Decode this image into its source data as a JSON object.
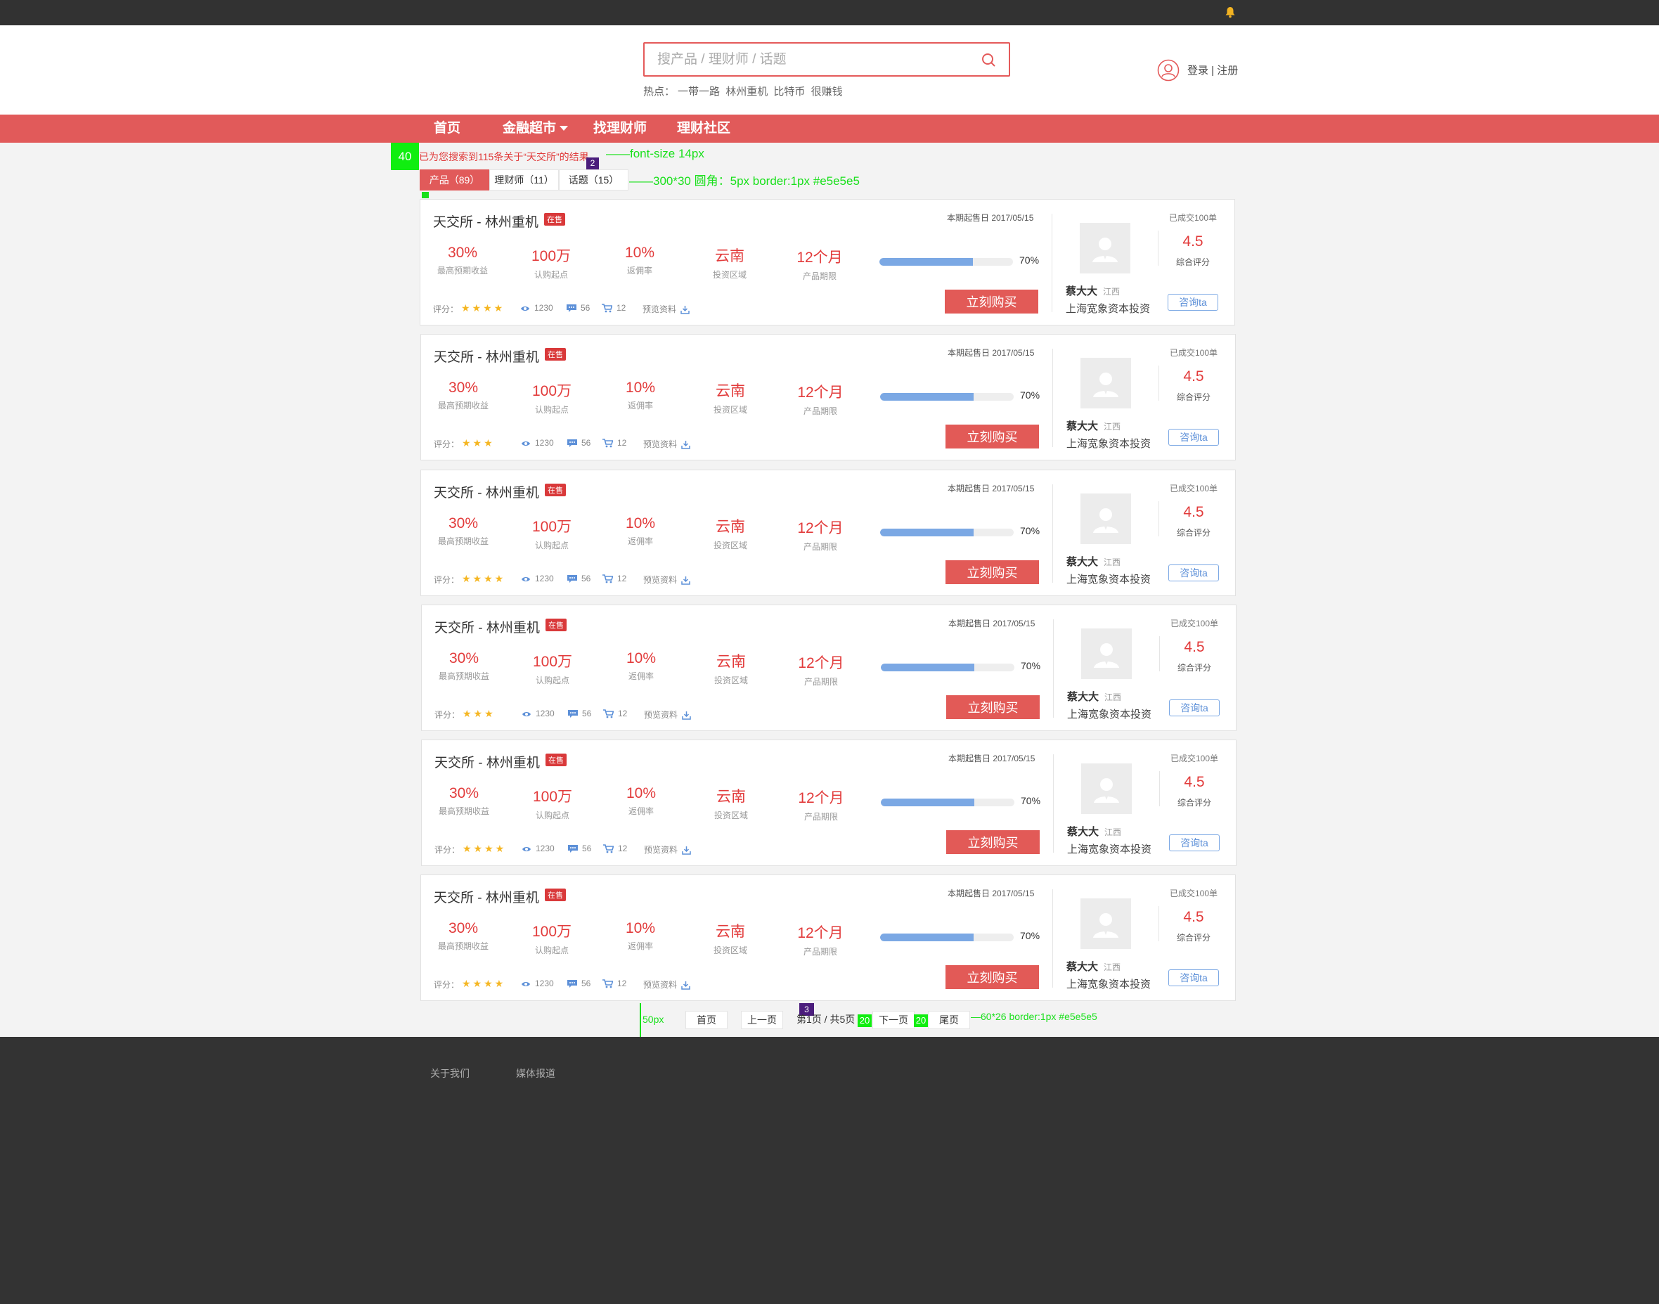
{
  "header": {
    "search_placeholder": "搜产品 / 理财师 / 话题",
    "hot_label": "热点：",
    "hot_words": [
      "一带一路",
      "林州重机",
      "比特币",
      "很赚钱"
    ],
    "login_text": "登录 | 注册"
  },
  "nav": {
    "items": [
      "首页",
      "金融超市",
      "找理财师",
      "理财社区"
    ]
  },
  "search_result": {
    "summary": "已为您搜索到115条关于“天交所”的结果"
  },
  "tabs": [
    {
      "label": "产品（89）",
      "active": true
    },
    {
      "label": "理财师（11）",
      "active": false
    },
    {
      "label": "话题（15）",
      "active": false
    }
  ],
  "annotations": {
    "box40": "40",
    "font_note": "——font-size 14px",
    "badge2": "2",
    "tab_note": "——300*30 圆角：5px border:1px #e5e5e5",
    "badge3": "3",
    "px50": "50px",
    "gap20a": "20",
    "gap20b": "20",
    "pg_note": "—60*26 border:1px #e5e5e5"
  },
  "products": [
    {
      "title": "天交所 - 林州重机",
      "badge": "在售",
      "date": "本期起售日 2017/05/15",
      "metrics": [
        {
          "value": "30%",
          "label": "最高预期收益"
        },
        {
          "value": "100万",
          "label": "认购起点"
        },
        {
          "value": "10%",
          "label": "返佣率"
        },
        {
          "value": "云南",
          "label": "投资区域"
        },
        {
          "value": "12个月",
          "label": "产品期限"
        }
      ],
      "progress": 70,
      "progress_text": "70%",
      "rating_label": "评分：",
      "stars": "★★★★",
      "views": "1230",
      "comments": "56",
      "cart": "12",
      "material": "预览资料",
      "buy": "立刻购买",
      "advisor": "蔡大大",
      "region": "江西",
      "company": "上海宽象资本投资",
      "deals": "已成交100单",
      "score": "4.5",
      "score_label": "综合评分",
      "consult": "咨询ta"
    },
    {
      "title": "天交所 - 林州重机",
      "badge": "在售",
      "date": "本期起售日 2017/05/15",
      "metrics": [
        {
          "value": "30%",
          "label": "最高预期收益"
        },
        {
          "value": "100万",
          "label": "认购起点"
        },
        {
          "value": "10%",
          "label": "返佣率"
        },
        {
          "value": "云南",
          "label": "投资区域"
        },
        {
          "value": "12个月",
          "label": "产品期限"
        }
      ],
      "progress": 70,
      "progress_text": "70%",
      "rating_label": "评分：",
      "stars": "★★★",
      "views": "1230",
      "comments": "56",
      "cart": "12",
      "material": "预览资料",
      "buy": "立刻购买",
      "advisor": "蔡大大",
      "region": "江西",
      "company": "上海宽象资本投资",
      "deals": "已成交100单",
      "score": "4.5",
      "score_label": "综合评分",
      "consult": "咨询ta"
    },
    {
      "title": "天交所 - 林州重机",
      "badge": "在售",
      "date": "本期起售日 2017/05/15",
      "metrics": [
        {
          "value": "30%",
          "label": "最高预期收益"
        },
        {
          "value": "100万",
          "label": "认购起点"
        },
        {
          "value": "10%",
          "label": "返佣率"
        },
        {
          "value": "云南",
          "label": "投资区域"
        },
        {
          "value": "12个月",
          "label": "产品期限"
        }
      ],
      "progress": 70,
      "progress_text": "70%",
      "rating_label": "评分：",
      "stars": "★★★★",
      "views": "1230",
      "comments": "56",
      "cart": "12",
      "material": "预览资料",
      "buy": "立刻购买",
      "advisor": "蔡大大",
      "region": "江西",
      "company": "上海宽象资本投资",
      "deals": "已成交100单",
      "score": "4.5",
      "score_label": "综合评分",
      "consult": "咨询ta"
    },
    {
      "title": "天交所 - 林州重机",
      "badge": "在售",
      "date": "本期起售日 2017/05/15",
      "metrics": [
        {
          "value": "30%",
          "label": "最高预期收益"
        },
        {
          "value": "100万",
          "label": "认购起点"
        },
        {
          "value": "10%",
          "label": "返佣率"
        },
        {
          "value": "云南",
          "label": "投资区域"
        },
        {
          "value": "12个月",
          "label": "产品期限"
        }
      ],
      "progress": 70,
      "progress_text": "70%",
      "rating_label": "评分：",
      "stars": "★★★",
      "views": "1230",
      "comments": "56",
      "cart": "12",
      "material": "预览资料",
      "buy": "立刻购买",
      "advisor": "蔡大大",
      "region": "江西",
      "company": "上海宽象资本投资",
      "deals": "已成交100单",
      "score": "4.5",
      "score_label": "综合评分",
      "consult": "咨询ta"
    },
    {
      "title": "天交所 - 林州重机",
      "badge": "在售",
      "date": "本期起售日 2017/05/15",
      "metrics": [
        {
          "value": "30%",
          "label": "最高预期收益"
        },
        {
          "value": "100万",
          "label": "认购起点"
        },
        {
          "value": "10%",
          "label": "返佣率"
        },
        {
          "value": "云南",
          "label": "投资区域"
        },
        {
          "value": "12个月",
          "label": "产品期限"
        }
      ],
      "progress": 70,
      "progress_text": "70%",
      "rating_label": "评分：",
      "stars": "★★★★",
      "views": "1230",
      "comments": "56",
      "cart": "12",
      "material": "预览资料",
      "buy": "立刻购买",
      "advisor": "蔡大大",
      "region": "江西",
      "company": "上海宽象资本投资",
      "deals": "已成交100单",
      "score": "4.5",
      "score_label": "综合评分",
      "consult": "咨询ta"
    },
    {
      "title": "天交所 - 林州重机",
      "badge": "在售",
      "date": "本期起售日 2017/05/15",
      "metrics": [
        {
          "value": "30%",
          "label": "最高预期收益"
        },
        {
          "value": "100万",
          "label": "认购起点"
        },
        {
          "value": "10%",
          "label": "返佣率"
        },
        {
          "value": "云南",
          "label": "投资区域"
        },
        {
          "value": "12个月",
          "label": "产品期限"
        }
      ],
      "progress": 70,
      "progress_text": "70%",
      "rating_label": "评分：",
      "stars": "★★★★",
      "views": "1230",
      "comments": "56",
      "cart": "12",
      "material": "预览资料",
      "buy": "立刻购买",
      "advisor": "蔡大大",
      "region": "江西",
      "company": "上海宽象资本投资",
      "deals": "已成交100单",
      "score": "4.5",
      "score_label": "综合评分",
      "consult": "咨询ta"
    }
  ],
  "pagination": {
    "first": "首页",
    "prev": "上一页",
    "info": "第1页 / 共5页",
    "next": "下一页",
    "last": "尾页"
  },
  "footer": {
    "links": [
      "关于我们",
      "媒体报道"
    ]
  },
  "colors": {
    "brand_red": "#e15a5a",
    "value_red": "#e23b3b",
    "progress_blue": "#7ba8e4",
    "topbar": "#323232",
    "footer": "#333333",
    "annotation_green": "#19e01b"
  }
}
